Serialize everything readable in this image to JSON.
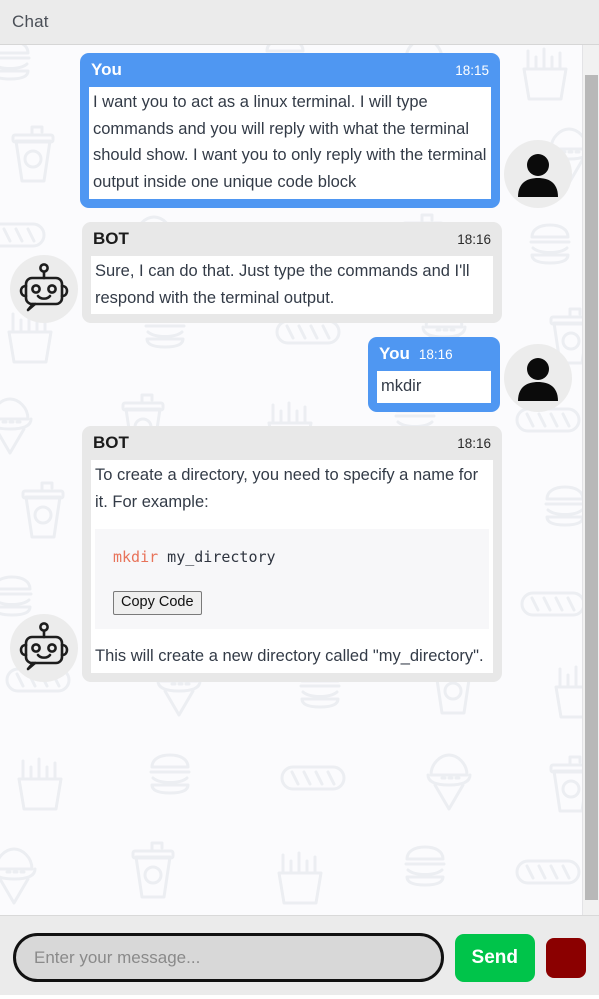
{
  "header": {
    "title": "Chat"
  },
  "colors": {
    "user_bubble": "#4f97f2",
    "bot_bubble": "#e8e8e8",
    "send_button": "#00c44a",
    "extra_button": "#8b0000",
    "code_keyword": "#e8735a",
    "background": "#fbfbfd"
  },
  "messages": [
    {
      "sender": "You",
      "time": "18:15",
      "side": "user",
      "text": "I want you to act as a linux terminal. I will type commands and you will reply with what the terminal should show. I want you to only reply with the terminal output inside one unique code block",
      "avatar": "user-avatar-icon"
    },
    {
      "sender": "BOT",
      "time": "18:16",
      "side": "bot",
      "text": "Sure, I can do that. Just type the commands and I'll respond with the terminal output.",
      "avatar": "robot-avatar-icon"
    },
    {
      "sender": "You",
      "time": "18:16",
      "side": "user",
      "text": "mkdir",
      "avatar": "user-avatar-icon"
    },
    {
      "sender": "BOT",
      "time": "18:16",
      "side": "bot",
      "text_before": "To create a directory, you need to specify a name for it. For example:",
      "code": {
        "keyword": "mkdir",
        "argument": " my_directory",
        "copy_label": "Copy Code"
      },
      "text_after": "This will create a new directory called \"my_directory\".",
      "avatar": "robot-avatar-icon"
    }
  ],
  "composer": {
    "placeholder": "Enter your message...",
    "value": "",
    "send_label": "Send",
    "extra_label": ""
  }
}
